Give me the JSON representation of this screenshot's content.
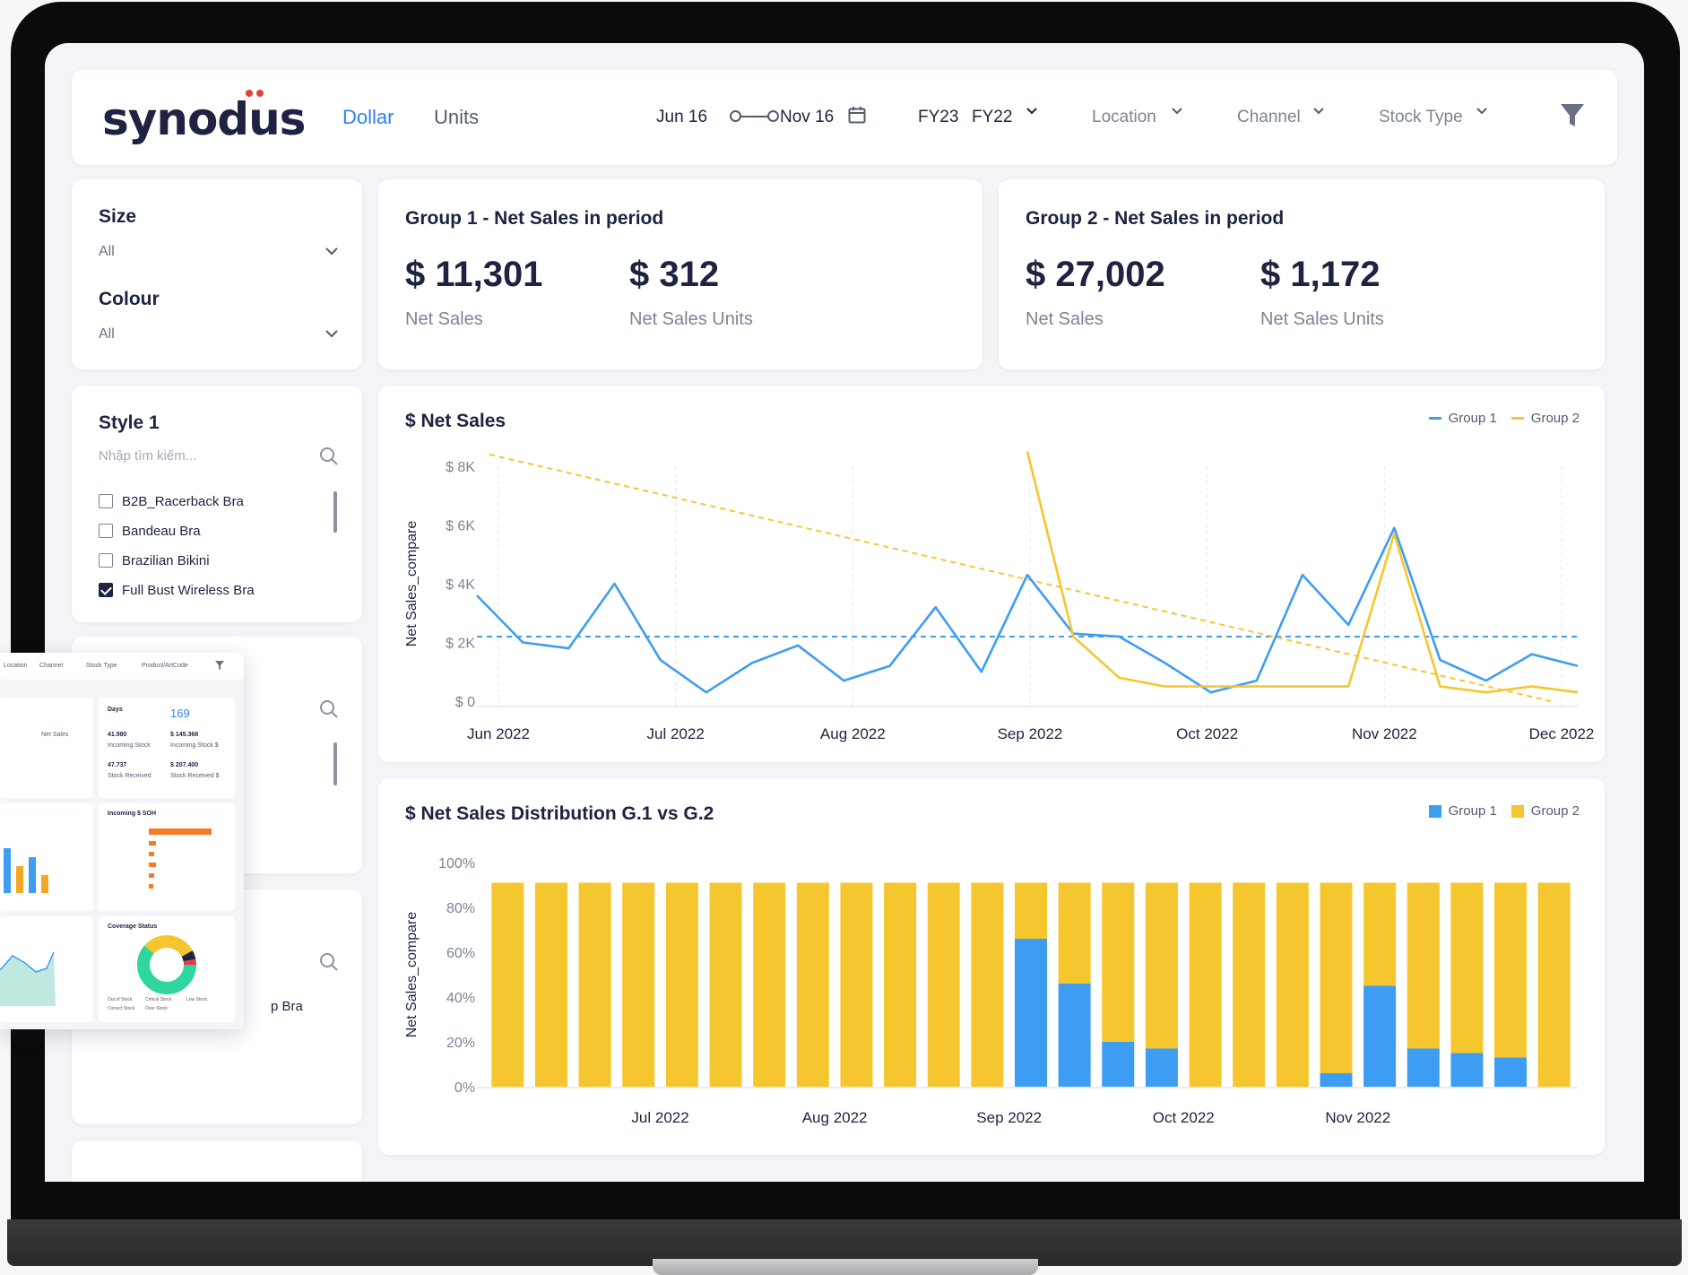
{
  "header": {
    "logo": "synodus",
    "tabs": [
      {
        "label": "Dollar",
        "active": true
      },
      {
        "label": "Units",
        "active": false
      }
    ],
    "date_start": "Jun 16",
    "date_end": "Nov 16",
    "fy_primary": "FY23",
    "fy_compare": "FY22",
    "filters": [
      "Location",
      "Channel",
      "Stock Type"
    ]
  },
  "sidebar": {
    "size": {
      "label": "Size",
      "value": "All"
    },
    "colour": {
      "label": "Colour",
      "value": "All"
    },
    "style": {
      "label": "Style 1",
      "search_placeholder": "Nhập tìm kiếm...",
      "options": [
        {
          "label": "B2B_Racerback Bra",
          "checked": false
        },
        {
          "label": "Bandeau Bra",
          "checked": false
        },
        {
          "label": "Brazilian Bikini",
          "checked": false
        },
        {
          "label": "Full Bust Wireless Bra",
          "checked": true
        }
      ]
    },
    "partial_item": "p Bra"
  },
  "kpi": [
    {
      "title": "Group 1 - Net Sales in period",
      "net_sales": "$ 11,301",
      "net_sales_label": "Net Sales",
      "units": "$ 312",
      "units_label": "Net Sales Units"
    },
    {
      "title": "Group 2 - Net Sales in period",
      "net_sales": "$ 27,002",
      "net_sales_label": "Net Sales",
      "units": "$ 1,172",
      "units_label": "Net Sales Units"
    }
  ],
  "colors": {
    "group1": "#3d9df3",
    "group2": "#f5c62e",
    "text": "#1d2340",
    "accent": "#2f80ed"
  },
  "chart_data": [
    {
      "type": "line",
      "title": "$ Net Sales",
      "ylabel": "Net Sales_compare",
      "ylim": [
        0,
        8000
      ],
      "y_ticks": [
        "$ 8K",
        "$ 6K",
        "$ 4K",
        "$ 2K",
        "$ 0"
      ],
      "x_ticks": [
        "Jun 2022",
        "Jul 2022",
        "Aug 2022",
        "Sep 2022",
        "Oct 2022",
        "Nov 2022",
        "Dec 2022"
      ],
      "grid": "vertical dashed",
      "legend": "top-right",
      "series": [
        {
          "name": "Group 1",
          "color": "#3d9df3",
          "values": [
            3600,
            2000,
            1800,
            4000,
            1400,
            300,
            1300,
            1900,
            700,
            1200,
            3200,
            1000,
            4300,
            2300,
            2200,
            1300,
            300,
            700,
            4300,
            2600,
            5900,
            1400,
            700,
            1600,
            1200
          ]
        },
        {
          "name": "Group 2",
          "color": "#f5c62e",
          "values": [
            null,
            null,
            null,
            null,
            null,
            null,
            null,
            null,
            null,
            null,
            null,
            null,
            8500,
            2200,
            800,
            500,
            500,
            500,
            500,
            500,
            5700,
            500,
            300,
            500,
            300
          ]
        }
      ],
      "reference_lines": [
        {
          "kind": "average",
          "series": "Group 1",
          "value": 2200
        },
        {
          "kind": "trend",
          "series": "Group 2",
          "from": 8400,
          "to": 0
        }
      ]
    },
    {
      "type": "bar",
      "stacked": true,
      "title": "$ Net Sales Distribution G.1 vs G.2",
      "ylabel": "Net Sales_compare",
      "ylim": [
        0,
        100
      ],
      "y_ticks": [
        "100%",
        "80%",
        "60%",
        "40%",
        "20%",
        "0%"
      ],
      "x_ticks": [
        "Jul 2022",
        "Aug 2022",
        "Sep 2022",
        "Oct 2022",
        "Nov 2022"
      ],
      "legend": "top-right",
      "series": [
        {
          "name": "Group 1",
          "color": "#3d9df3",
          "values": [
            0,
            0,
            0,
            0,
            0,
            0,
            0,
            0,
            0,
            0,
            0,
            0,
            66,
            46,
            20,
            17,
            0,
            0,
            0,
            6,
            45,
            17,
            15,
            13,
            0
          ]
        },
        {
          "name": "Group 2",
          "color": "#f5c62e",
          "values": [
            91,
            91,
            91,
            91,
            91,
            91,
            91,
            91,
            91,
            91,
            91,
            91,
            25,
            45,
            71,
            74,
            91,
            91,
            91,
            85,
            46,
            74,
            76,
            78,
            91
          ]
        }
      ]
    }
  ],
  "mini_dashboard": {
    "filters": [
      "Location",
      "Channel",
      "Stock Type",
      "Product/ArtCode"
    ],
    "days_label": "Days",
    "days_value": "169",
    "incoming_stock": "41.980",
    "incoming_stock_label": "Incoming Stock",
    "incoming_stock_dollar": "$ 145.368",
    "incoming_stock_dollar_label": "Incoming Stock $",
    "stock_received": "47.737",
    "stock_received_label": "Stock Received",
    "stock_received_dollar": "$ 207.400",
    "stock_received_dollar_label": "Stock Received $",
    "net_sales_label": "Net Sales",
    "incoming_soh_title": "Incoming $ SOH",
    "coverage_title": "Coverage Status",
    "coverage_legend": [
      "Out of Stock",
      "Critical Stock",
      "Low Stock",
      "Correct Stock",
      "Over Stock"
    ]
  }
}
